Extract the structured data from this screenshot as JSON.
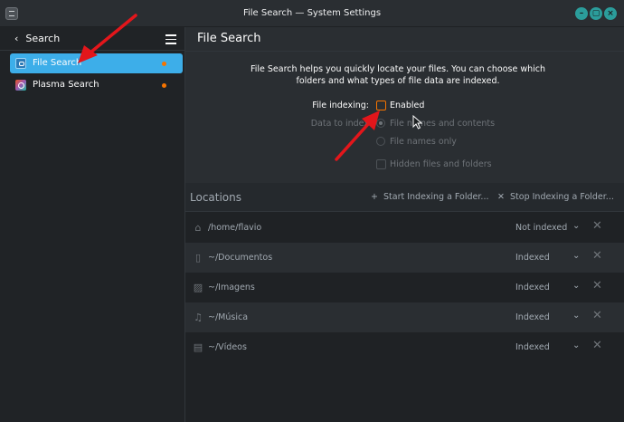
{
  "window": {
    "title": "File Search — System Settings"
  },
  "sidebar": {
    "back_label": "Search",
    "items": [
      {
        "label": "File Search",
        "icon": "file-search-icon",
        "active": true
      },
      {
        "label": "Plasma Search",
        "icon": "plasma-search-icon",
        "active": false
      }
    ]
  },
  "main": {
    "page_title": "File Search",
    "description": "File Search helps you quickly locate your files. You can choose which folders and what types of file data are indexed.",
    "file_indexing_label": "File indexing:",
    "enabled_label": "Enabled",
    "data_to_index_label": "Data to index",
    "option_names_contents": "File names and contents",
    "option_names_only": "File names only",
    "option_hidden": "Hidden files and folders"
  },
  "locations": {
    "title": "Locations",
    "start_button": "Start Indexing a Folder...",
    "stop_button": "Stop Indexing a Folder...",
    "rows": [
      {
        "path": "/home/flavio",
        "status": "Not indexed",
        "icon": "home-icon"
      },
      {
        "path": "~/Documentos",
        "status": "Indexed",
        "icon": "documents-icon"
      },
      {
        "path": "~/Imagens",
        "status": "Indexed",
        "icon": "pictures-icon"
      },
      {
        "path": "~/Música",
        "status": "Indexed",
        "icon": "music-icon"
      },
      {
        "path": "~/Vídeos",
        "status": "Indexed",
        "icon": "videos-icon"
      }
    ]
  },
  "colors": {
    "accent": "#3daee9",
    "highlight_dot": "#f67400",
    "window_buttons": "#2b9d9b",
    "annotation_arrow": "#e3161b"
  }
}
